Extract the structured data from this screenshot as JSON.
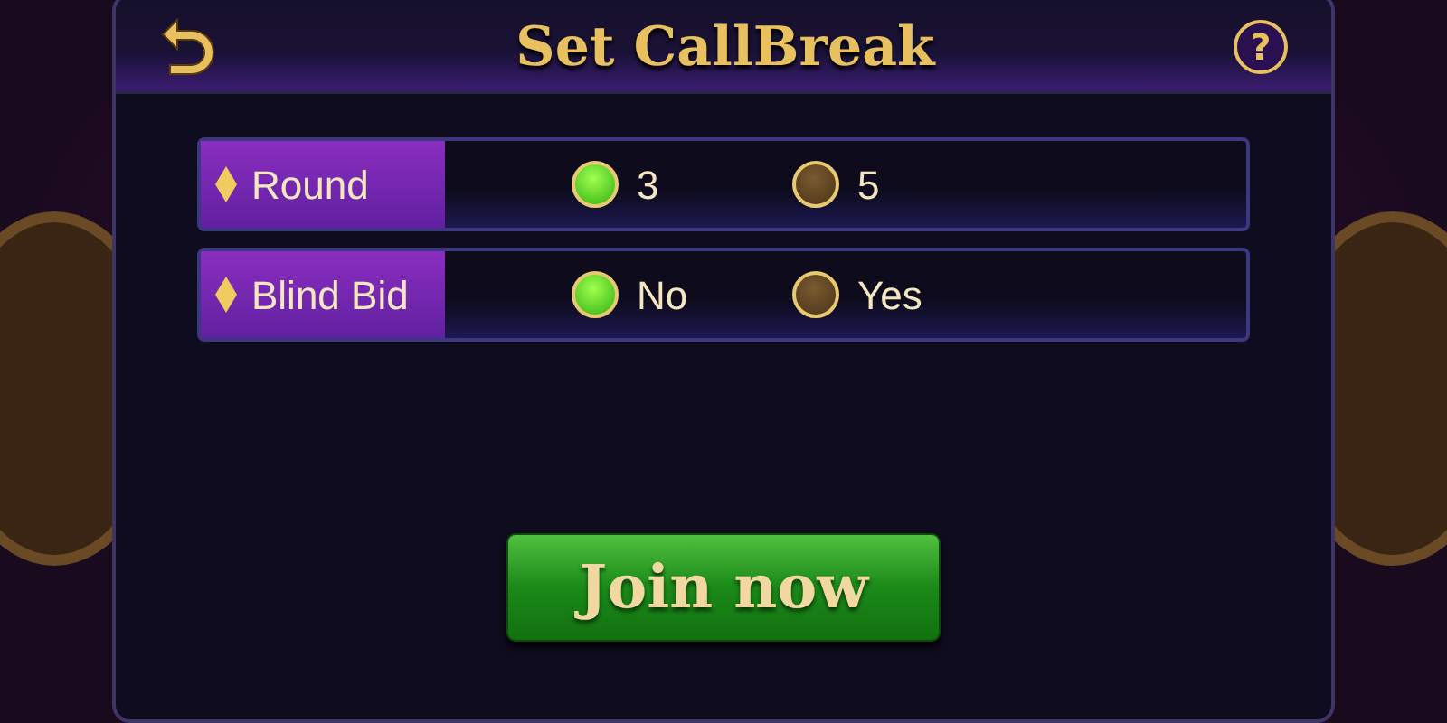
{
  "header": {
    "title": "Set CallBreak",
    "help": "?"
  },
  "settings": [
    {
      "label": "Round",
      "options": [
        {
          "label": "3",
          "selected": true
        },
        {
          "label": "5",
          "selected": false
        }
      ]
    },
    {
      "label": "Blind Bid",
      "options": [
        {
          "label": "No",
          "selected": true
        },
        {
          "label": "Yes",
          "selected": false
        }
      ]
    }
  ],
  "button": "Join now"
}
